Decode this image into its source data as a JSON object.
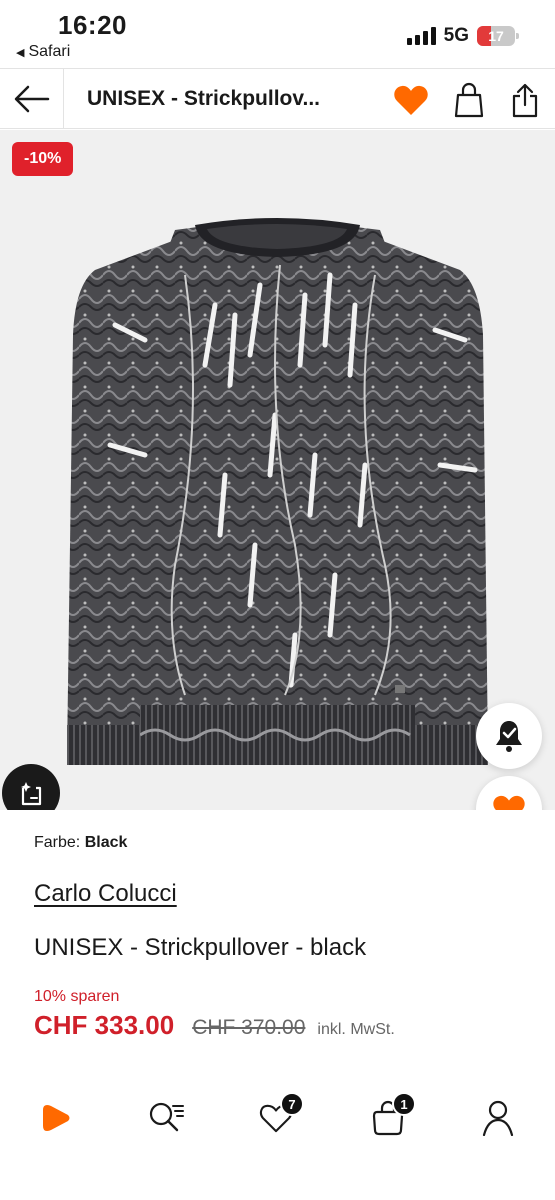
{
  "status_bar": {
    "time": "16:20",
    "back_app": "Safari",
    "network": "5G",
    "battery": "17"
  },
  "header": {
    "title": "UNISEX - Strickpullov..."
  },
  "image": {
    "discount_badge": "-10%"
  },
  "product": {
    "color_label": "Farbe:",
    "color_value": "Black",
    "brand": "Carlo Colucci",
    "name": "UNISEX - Strickpullover - black",
    "save_text": "10% sparen",
    "price_now": "CHF 333.00",
    "price_old": "CHF 370.00",
    "vat_note": "inkl. MwSt."
  },
  "bottom_nav": {
    "wishlist_count": "7",
    "bag_count": "1"
  },
  "colors": {
    "accent": "#ff6900",
    "sale_red": "#d0202a",
    "badge_red": "#e0212b"
  },
  "icons": [
    "back-arrow-icon",
    "heart-icon",
    "bag-icon",
    "share-icon",
    "bell-icon",
    "try-on-icon",
    "home-play-icon",
    "search-icon",
    "wishlist-icon",
    "cart-icon",
    "profile-icon"
  ]
}
